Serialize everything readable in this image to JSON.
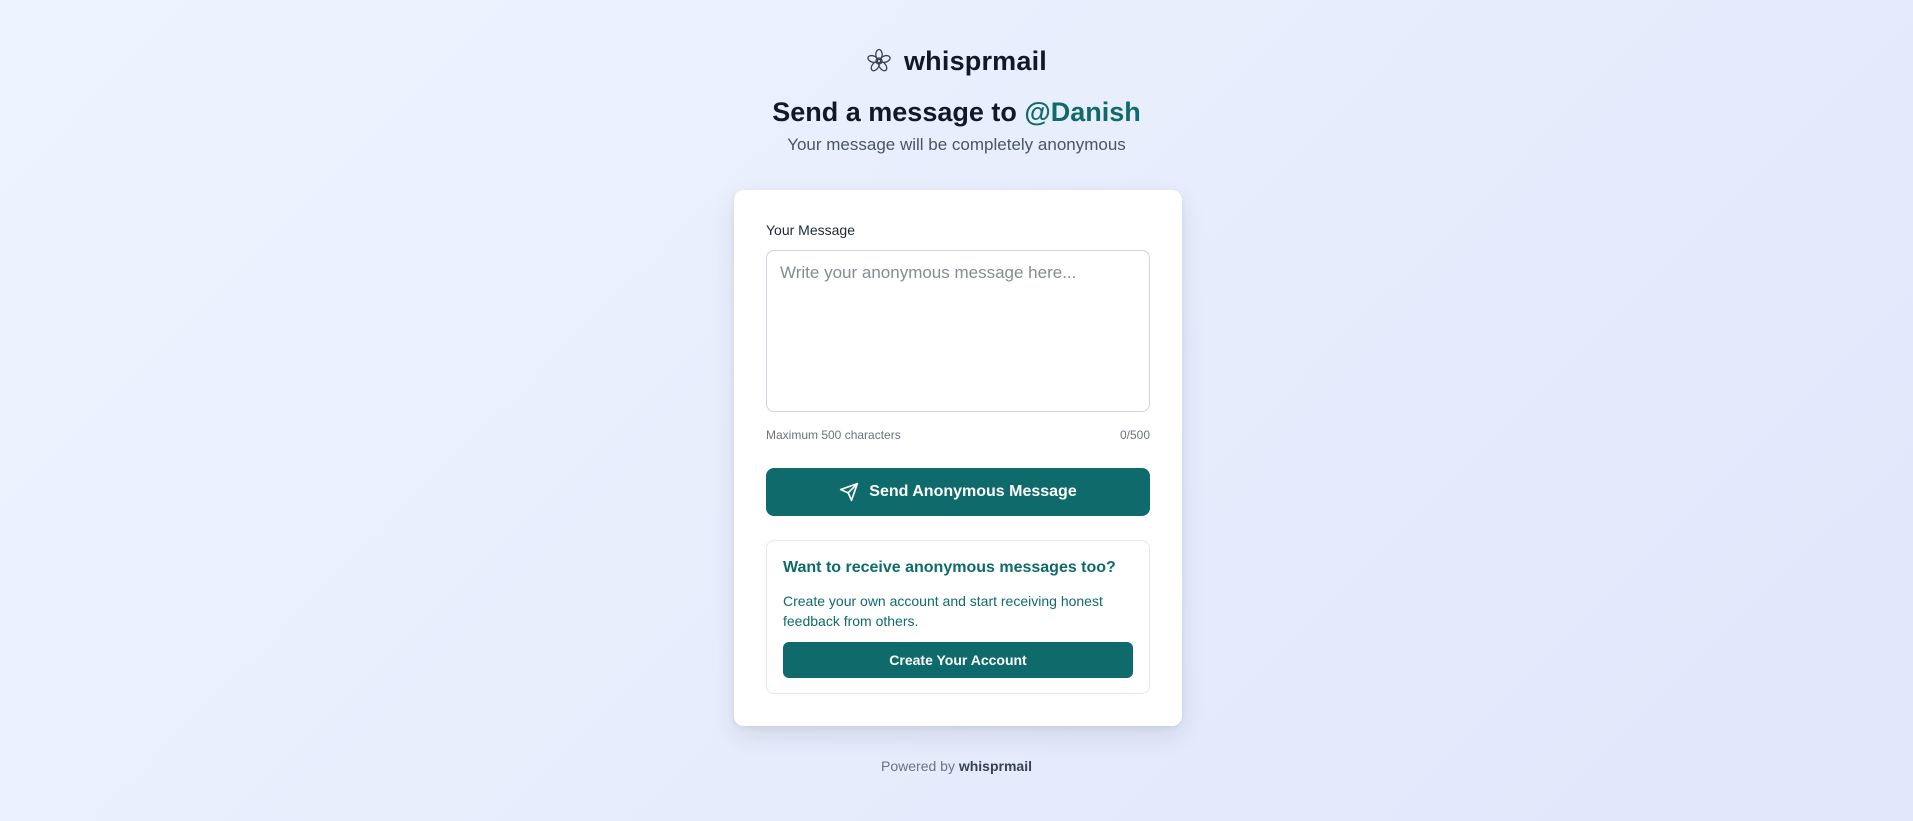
{
  "brand": {
    "name": "whisprmail",
    "logo_icon": "flower-logo-icon"
  },
  "heading": {
    "prefix": "Send a message to",
    "handle": "@Danish",
    "subtitle": "Your message will be completely anonymous"
  },
  "form": {
    "label": "Your Message",
    "placeholder": "Write your anonymous message here...",
    "value": "",
    "helper": "Maximum 500 characters",
    "counter": "0/500",
    "send_label": "Send Anonymous Message",
    "send_icon": "send-icon"
  },
  "promo": {
    "title": "Want to receive anonymous messages too?",
    "text": "Create your own account and start receiving honest feedback from others.",
    "button_label": "Create Your Account"
  },
  "footer": {
    "prefix": "Powered by",
    "brand": "whisprmail"
  },
  "colors": {
    "accent": "#0f6b6b",
    "background": "#e9efff",
    "text": "#111827"
  }
}
